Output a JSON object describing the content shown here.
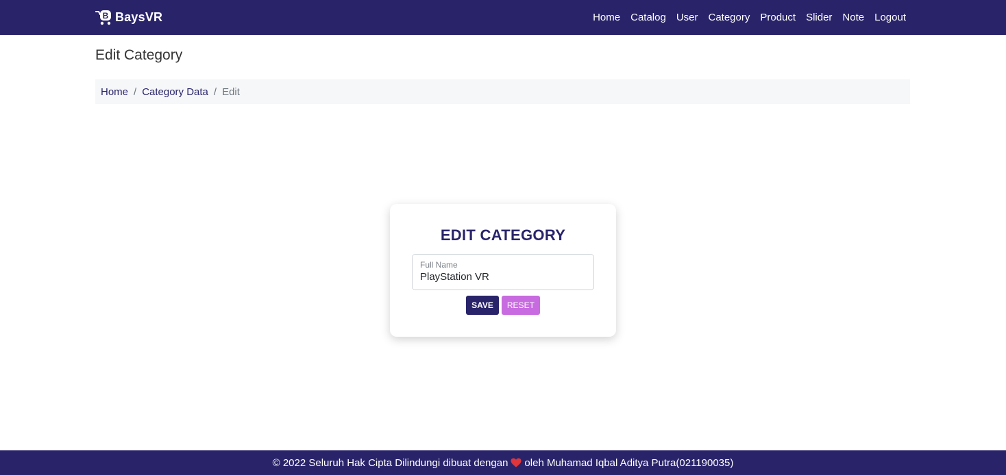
{
  "navbar": {
    "brand": "BaysVR",
    "brand_icon": "cart-logo-icon",
    "links": [
      "Home",
      "Catalog",
      "User",
      "Category",
      "Product",
      "Slider",
      "Note",
      "Logout"
    ]
  },
  "page": {
    "title": "Edit Category"
  },
  "breadcrumb": {
    "items": [
      "Home",
      "Category Data"
    ],
    "active": "Edit"
  },
  "card": {
    "title": "EDIT CATEGORY",
    "field_label": "Full Name",
    "field_value": "PlayStation VR",
    "save_label": "SAVE",
    "reset_label": "RESET"
  },
  "footer": {
    "text_before": "© 2022 Seluruh Hak Cipta Dilindungi dibuat dengan",
    "icon": "heart-icon",
    "text_after": "oleh Muhamad Iqbal Aditya Putra(021190035)"
  },
  "colors": {
    "primary": "#29246a",
    "accent": "#c86be0",
    "heart": "#e0353b"
  }
}
